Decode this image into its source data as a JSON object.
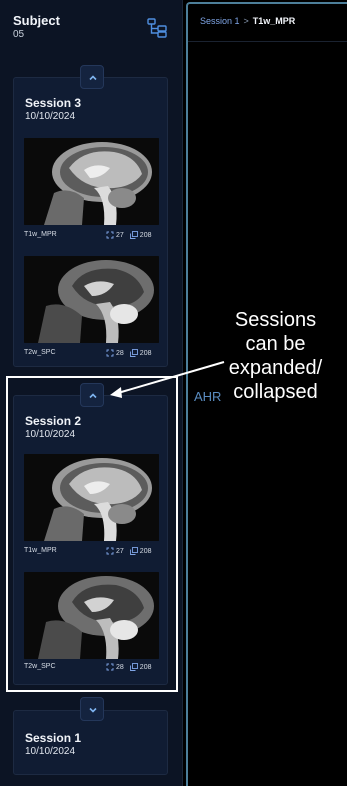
{
  "sidebar": {
    "subject_title": "Subject",
    "subject_id": "05",
    "layout_icon": "layout-tree-icon",
    "sessions": [
      {
        "title": "Session 3",
        "date": "10/10/2024",
        "expanded": true,
        "series": [
          {
            "name": "T1w_MPR",
            "dims": "27",
            "count": "208"
          },
          {
            "name": "T2w_SPC",
            "dims": "28",
            "count": "208"
          }
        ]
      },
      {
        "title": "Session 2",
        "date": "10/10/2024",
        "expanded": true,
        "series": [
          {
            "name": "T1w_MPR",
            "dims": "27",
            "count": "208"
          },
          {
            "name": "T2w_SPC",
            "dims": "28",
            "count": "208"
          }
        ]
      },
      {
        "title": "Session 1",
        "date": "10/10/2024",
        "expanded": false,
        "series": []
      }
    ]
  },
  "viewport": {
    "breadcrumb": {
      "parent": "Session 1",
      "separator": ">",
      "current": "T1w_MPR"
    },
    "orientation_label": "AHR"
  },
  "annotation": {
    "line1": "Sessions",
    "line2": "can be",
    "line3": "expanded/",
    "line4": "collapsed"
  },
  "colors": {
    "sidebar_bg": "#0c1424",
    "card_bg": "#101c33",
    "viewport_border": "#4d7f9a",
    "breadcrumb_link": "#7fa5e6",
    "orientation": "#5a8cc0"
  }
}
